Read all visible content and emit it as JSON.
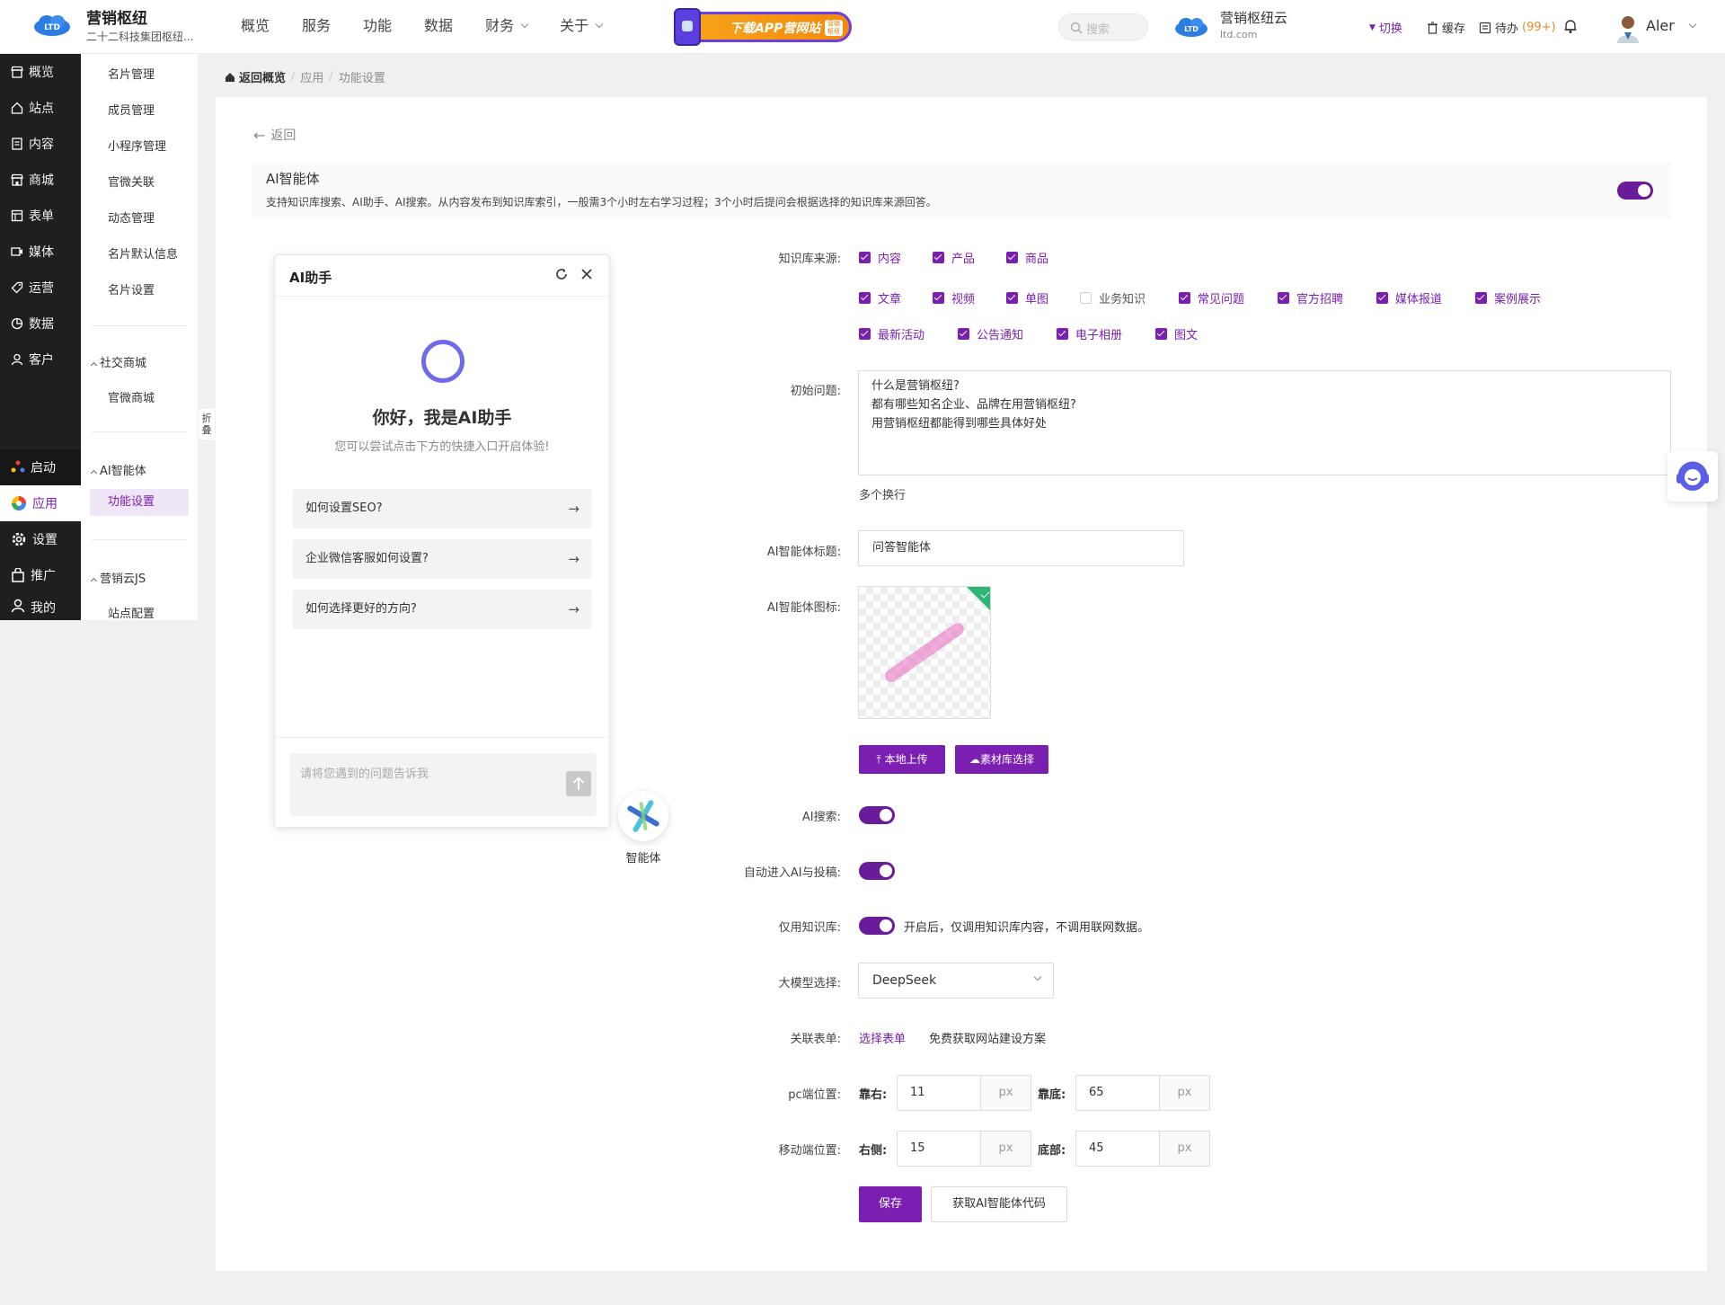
{
  "app": {
    "brand_name": "营销枢纽",
    "brand_sub": "二十二科技集团枢纽..."
  },
  "topnav": [
    {
      "label": "概览",
      "has_caret": false
    },
    {
      "label": "服务",
      "has_caret": false
    },
    {
      "label": "功能",
      "has_caret": false
    },
    {
      "label": "数据",
      "has_caret": false
    },
    {
      "label": "财务",
      "has_caret": true
    },
    {
      "label": "关于",
      "has_caret": true
    }
  ],
  "banner": {
    "text": "下载APP营网站",
    "tag": "营销枢纽"
  },
  "search": {
    "placeholder": "搜索"
  },
  "cloud": {
    "name": "营销枢纽云",
    "domain": "ltd.com"
  },
  "top_actions": {
    "switch": "切换",
    "cache": "缓存",
    "todo": "待办",
    "todo_count": "(99+)"
  },
  "user": {
    "name": "Aler"
  },
  "sidebar": {
    "items": [
      {
        "label": "概览",
        "icon": "shop-icon"
      },
      {
        "label": "站点",
        "icon": "home-icon"
      },
      {
        "label": "内容",
        "icon": "document-icon"
      },
      {
        "label": "商城",
        "icon": "store-icon"
      },
      {
        "label": "表单",
        "icon": "form-icon"
      },
      {
        "label": "媒体",
        "icon": "media-icon"
      },
      {
        "label": "运营",
        "icon": "tag-icon"
      },
      {
        "label": "数据",
        "icon": "chart-pie-icon"
      },
      {
        "label": "客户",
        "icon": "user-icon"
      }
    ],
    "launch": "启动",
    "app": "应用",
    "settings": "设置",
    "promote": "推广",
    "mine": "我的",
    "accent": "#7a1fb2"
  },
  "subnav": {
    "items1": [
      "名片管理",
      "成员管理",
      "小程序管理",
      "官微关联",
      "动态管理",
      "名片默认信息",
      "名片设置"
    ],
    "group_social": "社交商城",
    "social_items": [
      "官微商城"
    ],
    "group_ai": "AI智能体",
    "ai_active": "功能设置",
    "group_js": "营销云JS",
    "js_items": [
      "站点配置"
    ],
    "collapse": "折叠"
  },
  "breadcrumb": {
    "home": "返回概览",
    "level1": "应用",
    "level2": "功能设置"
  },
  "page": {
    "back": "返回",
    "feature_title": "AI智能体",
    "feature_desc": "支持知识库搜索、AI助手、AI搜索。从内容发布到知识库索引，一般需3个小时左右学习过程；3个小时后提问会根据选择的知识库来源回答。",
    "feature_enabled": true
  },
  "chat": {
    "title": "AI助手",
    "greeting": "你好，我是AI助手",
    "hint": "您可以尝试点击下方的快捷入口开启体验!",
    "quick": [
      "如何设置SEO?",
      "企业微信客服如何设置?",
      "如何选择更好的方向?"
    ],
    "input_placeholder": "请将您遇到的问题告诉我",
    "fab_label": "智能体"
  },
  "form": {
    "knowledge_label": "知识库来源:",
    "knowledge_sources": [
      {
        "label": "内容",
        "checked": true
      },
      {
        "label": "产品",
        "checked": true
      },
      {
        "label": "商品",
        "checked": true
      },
      {
        "label": "文章",
        "checked": true
      },
      {
        "label": "视频",
        "checked": true
      },
      {
        "label": "单图",
        "checked": true
      },
      {
        "label": "业务知识",
        "checked": false
      },
      {
        "label": "常见问题",
        "checked": true
      },
      {
        "label": "官方招聘",
        "checked": true
      },
      {
        "label": "媒体报道",
        "checked": true
      },
      {
        "label": "案例展示",
        "checked": true
      },
      {
        "label": "最新活动",
        "checked": true
      },
      {
        "label": "公告通知",
        "checked": true
      },
      {
        "label": "电子相册",
        "checked": true
      },
      {
        "label": "图文",
        "checked": true
      }
    ],
    "initial_label": "初始问题:",
    "initial_questions": [
      "什么是营销枢纽?",
      "都有哪些知名企业、品牌在用营销枢纽?",
      "用营销枢纽都能得到哪些具体好处"
    ],
    "multi_line_hint": "多个换行",
    "title_label": "AI智能体标题:",
    "title_value": "问答智能体",
    "icon_label": "AI智能体图标:",
    "upload_local": "本地上传",
    "upload_library": "素材库选择",
    "ai_search_label": "AI搜索:",
    "auto_enter_label": "自动进入AI与投稿:",
    "knowledge_only_label": "仅用知识库:",
    "knowledge_only_note": "开启后，仅调用知识库内容，不调用联网数据。",
    "model_label": "大模型选择:",
    "model_value": "DeepSeek",
    "related_form_label": "关联表单:",
    "related_form_link": "选择表单",
    "related_form_note": "免费获取网站建设方案",
    "pc_label": "pc端位置:",
    "pc_right_label": "靠右:",
    "pc_right": "11",
    "pc_bottom_label": "靠底:",
    "pc_bottom": "65",
    "mobile_label": "移动端位置:",
    "mobile_right_label": "右侧:",
    "mobile_right": "15",
    "mobile_bottom_label": "底部:",
    "mobile_bottom": "45",
    "unit": "px",
    "save": "保存",
    "get_code": "获取AI智能体代码"
  }
}
